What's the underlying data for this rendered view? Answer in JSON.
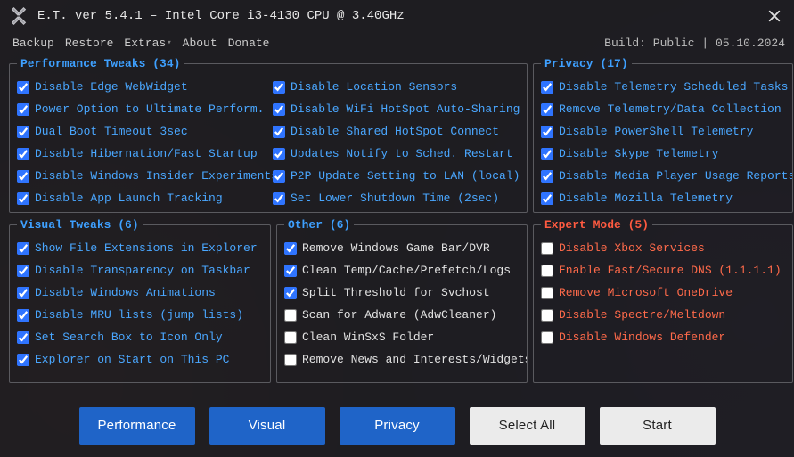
{
  "title": "E.T. ver 5.4.1   –   Intel Core i3-4130 CPU @ 3.40GHz",
  "menubar": {
    "items": [
      "Backup",
      "Restore",
      "Extras",
      "About",
      "Donate"
    ],
    "build_label": "Build: Public | 05.10.2024"
  },
  "sections": {
    "performance": {
      "legend": "Performance Tweaks (34)",
      "colA": [
        "Disable Edge WebWidget",
        "Power Option to Ultimate Perform.",
        "Dual Boot Timeout 3sec",
        "Disable Hibernation/Fast Startup",
        "Disable Windows Insider Experiments",
        "Disable App Launch Tracking"
      ],
      "colB": [
        "Disable Location Sensors",
        "Disable WiFi HotSpot Auto-Sharing",
        "Disable Shared HotSpot Connect",
        "Updates Notify to Sched. Restart",
        "P2P Update Setting to LAN (local)",
        "Set Lower Shutdown Time (2sec)"
      ]
    },
    "privacy": {
      "legend": "Privacy (17)",
      "items": [
        "Disable Telemetry Scheduled Tasks",
        "Remove Telemetry/Data Collection",
        "Disable PowerShell Telemetry",
        "Disable Skype Telemetry",
        "Disable Media Player Usage Reports",
        "Disable Mozilla Telemetry"
      ]
    },
    "visual": {
      "legend": "Visual Tweaks (6)",
      "items": [
        "Show File Extensions in Explorer",
        "Disable Transparency on Taskbar",
        "Disable Windows Animations",
        "Disable MRU lists (jump lists)",
        "Set Search Box to Icon Only",
        "Explorer on Start on This PC"
      ]
    },
    "other": {
      "legend": "Other (6)",
      "items": [
        {
          "label": "Remove Windows Game Bar/DVR",
          "checked": true
        },
        {
          "label": "Clean Temp/Cache/Prefetch/Logs",
          "checked": true
        },
        {
          "label": "Split Threshold for Svchost",
          "checked": true
        },
        {
          "label": "Scan for Adware (AdwCleaner)",
          "checked": false
        },
        {
          "label": "Clean WinSxS Folder",
          "checked": false
        },
        {
          "label": "Remove News and Interests/Widgets",
          "checked": false
        }
      ]
    },
    "expert": {
      "legend": "Expert Mode (5)",
      "items": [
        "Disable Xbox Services",
        "Enable Fast/Secure DNS (1.1.1.1)",
        "Remove Microsoft OneDrive",
        "Disable Spectre/Meltdown",
        "Disable Windows Defender"
      ]
    }
  },
  "buttons": {
    "performance": "Performance",
    "visual": "Visual",
    "privacy": "Privacy",
    "select_all": "Select All",
    "start": "Start"
  }
}
